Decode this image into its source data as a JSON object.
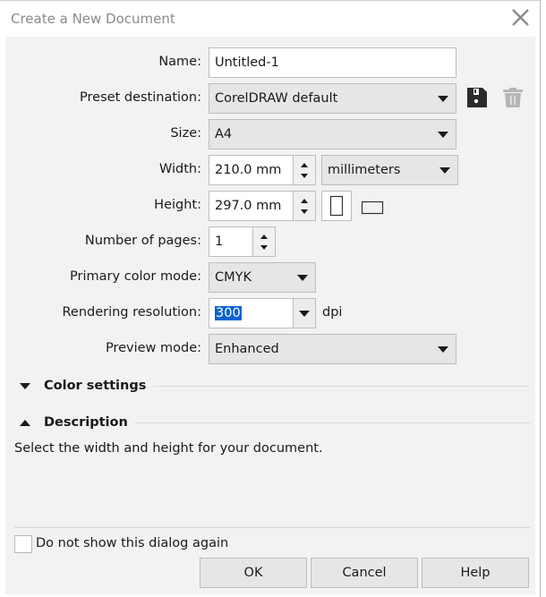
{
  "dialog": {
    "title": "Create a New Document",
    "close_icon": "close-icon"
  },
  "form": {
    "name": {
      "label": "Name:",
      "value": "Untitled-1"
    },
    "preset": {
      "label": "Preset destination:",
      "value": "CorelDRAW default",
      "save_icon": "floppy-disk-icon",
      "delete_icon": "trash-icon"
    },
    "size": {
      "label": "Size:",
      "value": "A4"
    },
    "width": {
      "label": "Width:",
      "value": "210.0 mm"
    },
    "units": {
      "value": "millimeters"
    },
    "height": {
      "label": "Height:",
      "value": "297.0 mm",
      "orientation_portrait_icon": "portrait-orientation-icon",
      "orientation_landscape_icon": "landscape-orientation-icon",
      "selected_orientation": "portrait"
    },
    "pages": {
      "label": "Number of pages:",
      "value": "1"
    },
    "color_mode": {
      "label": "Primary color mode:",
      "value": "CMYK"
    },
    "resolution": {
      "label": "Rendering resolution:",
      "value": "300",
      "unit": "dpi"
    },
    "preview": {
      "label": "Preview mode:",
      "value": "Enhanced"
    }
  },
  "sections": {
    "color_settings": {
      "title": "Color settings",
      "expanded": false
    },
    "description": {
      "title": "Description",
      "expanded": true,
      "text": "Select the width and height for your document."
    }
  },
  "footer": {
    "dont_show_label": "Do not show this dialog again",
    "dont_show_checked": false,
    "ok_label": "OK",
    "cancel_label": "Cancel",
    "help_label": "Help"
  },
  "colors": {
    "selection_highlight": "#0a64d0",
    "dialog_bg": "#f2f2f2"
  }
}
